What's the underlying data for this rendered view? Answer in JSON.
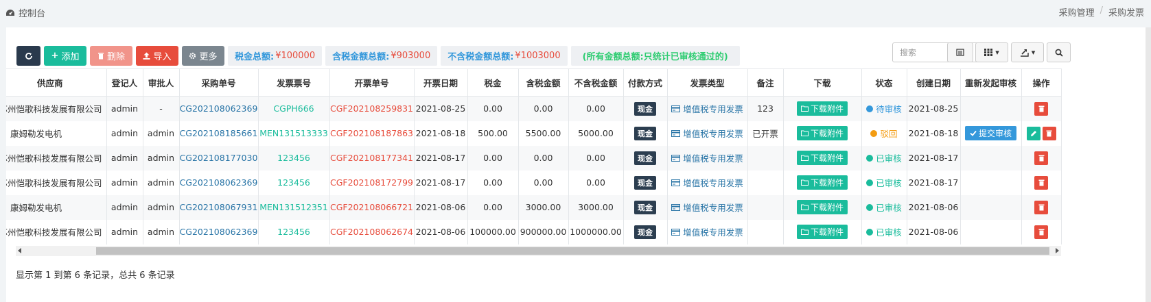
{
  "header": {
    "title": "控制台",
    "breadcrumb": [
      "采购管理",
      "采购发票"
    ]
  },
  "toolbar": {
    "add_label": "添加",
    "delete_label": "删除",
    "import_label": "导入",
    "more_label": "更多",
    "stats": {
      "tax_label": "税金总额:",
      "tax_value": "¥100000",
      "incl_label": "含税金额总额:",
      "incl_value": "¥903000",
      "excl_label": "不含税金额总额:",
      "excl_value": "¥1003000",
      "note": "(所有金额总额:只统计已审核通过的)"
    },
    "search_placeholder": "搜索"
  },
  "table": {
    "columns": [
      "供应商",
      "登记人",
      "审批人",
      "采购单号",
      "发票票号",
      "开票单号",
      "开票日期",
      "税金",
      "含税金额",
      "不含税金额",
      "付款方式",
      "发票类型",
      "备注",
      "下载",
      "状态",
      "创建日期",
      "重新发起审核",
      "操作"
    ],
    "rows": [
      {
        "supplier": "苏州恺歌科技发展有限公司",
        "registrar": "admin",
        "approver": "-",
        "po": "CG202108062369",
        "invoice_no": "CGPH666",
        "billing_no": "CGF202108259831",
        "date": "2021-08-25",
        "tax": "0.00",
        "incl": "0.00",
        "excl": "0.00",
        "pay": "现金",
        "type": "增值税专用发票",
        "remark": "123",
        "download": "下载附件",
        "status": "待审核",
        "status_color": "#3498db",
        "created": "2021-08-25",
        "resubmit": "",
        "can_edit": false
      },
      {
        "supplier": "康姆勒发电机",
        "registrar": "admin",
        "approver": "admin",
        "po": "CG202108185661",
        "invoice_no": "MEN131513333",
        "billing_no": "CGF202108187863",
        "date": "2021-08-18",
        "tax": "500.00",
        "incl": "5500.00",
        "excl": "5000.00",
        "pay": "现金",
        "type": "增值税专用发票",
        "remark": "已开票",
        "download": "下载附件",
        "status": "驳回",
        "status_color": "#f39c12",
        "created": "2021-08-18",
        "resubmit": "提交审核",
        "can_edit": true
      },
      {
        "supplier": "苏州恺歌科技发展有限公司",
        "registrar": "admin",
        "approver": "admin",
        "po": "CG202108177030",
        "invoice_no": "123456",
        "billing_no": "CGF202108177341",
        "date": "2021-08-17",
        "tax": "0.00",
        "incl": "0.00",
        "excl": "0.00",
        "pay": "现金",
        "type": "增值税专用发票",
        "remark": "",
        "download": "下载附件",
        "status": "已审核",
        "status_color": "#1abc9c",
        "created": "2021-08-17",
        "resubmit": "",
        "can_edit": false
      },
      {
        "supplier": "苏州恺歌科技发展有限公司",
        "registrar": "admin",
        "approver": "admin",
        "po": "CG202108062369",
        "invoice_no": "123456",
        "billing_no": "CGF202108172799",
        "date": "2021-08-17",
        "tax": "0.00",
        "incl": "0.00",
        "excl": "0.00",
        "pay": "现金",
        "type": "增值税专用发票",
        "remark": "",
        "download": "下载附件",
        "status": "已审核",
        "status_color": "#1abc9c",
        "created": "2021-08-17",
        "resubmit": "",
        "can_edit": false
      },
      {
        "supplier": "康姆勒发电机",
        "registrar": "admin",
        "approver": "admin",
        "po": "CG202108067931",
        "invoice_no": "MEN131512351",
        "billing_no": "CGF202108066721",
        "date": "2021-08-06",
        "tax": "0.00",
        "incl": "3000.00",
        "excl": "3000.00",
        "pay": "现金",
        "type": "增值税专用发票",
        "remark": "",
        "download": "下载附件",
        "status": "已审核",
        "status_color": "#1abc9c",
        "created": "2021-08-06",
        "resubmit": "",
        "can_edit": false
      },
      {
        "supplier": "苏州恺歌科技发展有限公司",
        "registrar": "admin",
        "approver": "admin",
        "po": "CG202108062369",
        "invoice_no": "123456",
        "billing_no": "CGF202108062674",
        "date": "2021-08-06",
        "tax": "100000.00",
        "incl": "900000.00",
        "excl": "1000000.00",
        "pay": "现金",
        "type": "增值税专用发票",
        "remark": "",
        "download": "下载附件",
        "status": "已审核",
        "status_color": "#1abc9c",
        "created": "2021-08-06",
        "resubmit": "",
        "can_edit": false
      }
    ]
  },
  "footer": {
    "summary": "显示第 1 到第 6 条记录，总共 6 条记录"
  }
}
